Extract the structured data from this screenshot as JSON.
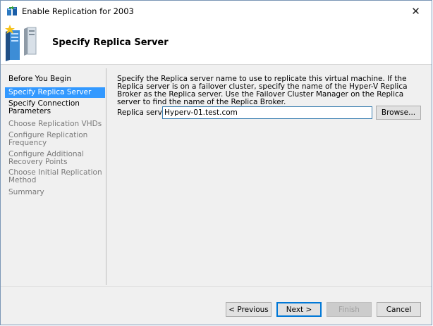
{
  "window": {
    "title": "Enable Replication for 2003",
    "close_glyph": "✕"
  },
  "header": {
    "title": "Specify Replica Server"
  },
  "sidebar": {
    "items": [
      {
        "label": "Before You Begin",
        "state": "done"
      },
      {
        "label": "Specify Replica Server",
        "state": "active"
      },
      {
        "label": "Specify Connection Parameters",
        "state": "done"
      },
      {
        "label": "Choose Replication VHDs",
        "state": "pending"
      },
      {
        "label": "Configure Replication Frequency",
        "state": "pending"
      },
      {
        "label": "Configure Additional Recovery Points",
        "state": "pending"
      },
      {
        "label": "Choose Initial Replication Method",
        "state": "pending"
      },
      {
        "label": "Summary",
        "state": "pending"
      }
    ]
  },
  "main": {
    "description": "Specify the Replica server name to use to replicate this virtual machine. If the Replica server is on a failover cluster, specify the name of the Hyper-V Replica Broker as the Replica server. Use the Failover Cluster Manager on the Replica server to find the name of the Replica Broker.",
    "replica_label": "Replica server:",
    "replica_value": "Hyperv-01.test.com",
    "browse_label": "Browse..."
  },
  "footer": {
    "previous_label": "< Previous",
    "next_label": "Next >",
    "finish_label": "Finish",
    "cancel_label": "Cancel"
  },
  "colors": {
    "selection": "#3399ff",
    "disabled_text": "#7a7a7a",
    "focus_border": "#0078d7"
  }
}
